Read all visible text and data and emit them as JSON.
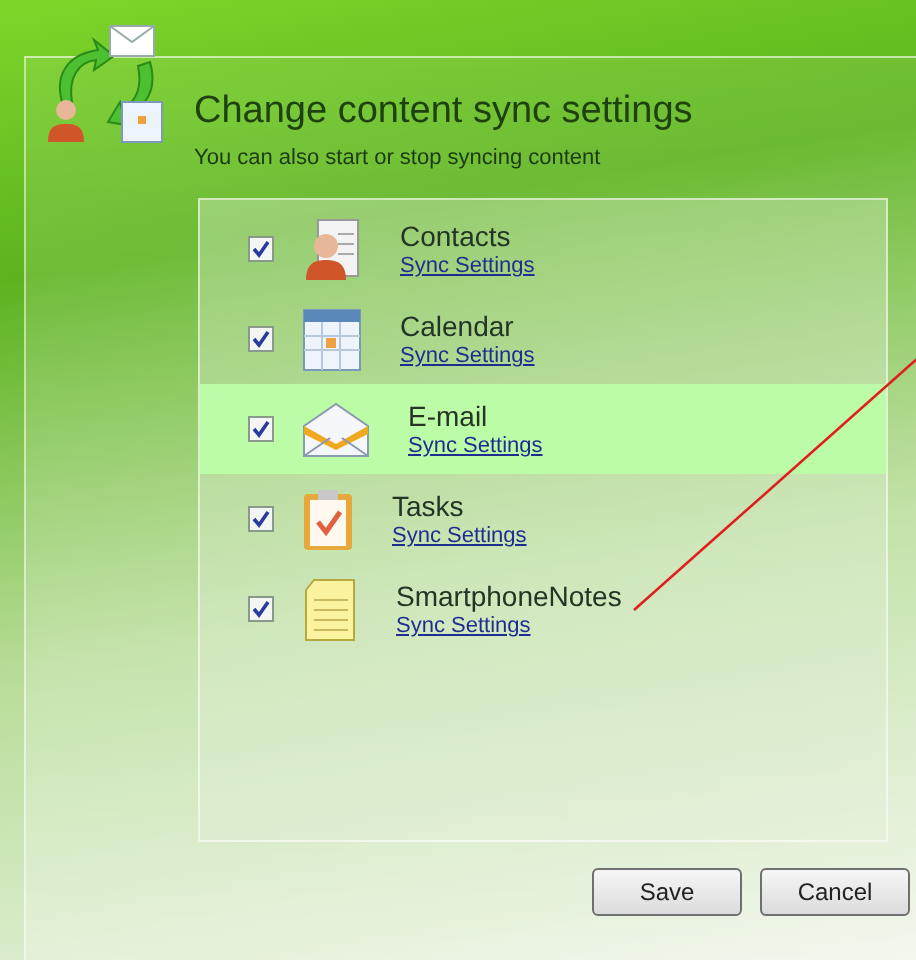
{
  "header": {
    "title": "Change content sync settings",
    "subtitle": "You can also start or stop syncing content"
  },
  "items": [
    {
      "kind": "contacts",
      "name": "Contacts",
      "link": "Sync Settings",
      "checked": true,
      "selected": false
    },
    {
      "kind": "calendar",
      "name": "Calendar",
      "link": "Sync Settings",
      "checked": true,
      "selected": false
    },
    {
      "kind": "email",
      "name": "E-mail",
      "link": "Sync Settings",
      "checked": true,
      "selected": true
    },
    {
      "kind": "tasks",
      "name": "Tasks",
      "link": "Sync Settings",
      "checked": true,
      "selected": false
    },
    {
      "kind": "notes",
      "name": "SmartphoneNotes",
      "link": "Sync Settings",
      "checked": true,
      "selected": false
    }
  ],
  "buttons": [
    "Save",
    "Cancel"
  ]
}
